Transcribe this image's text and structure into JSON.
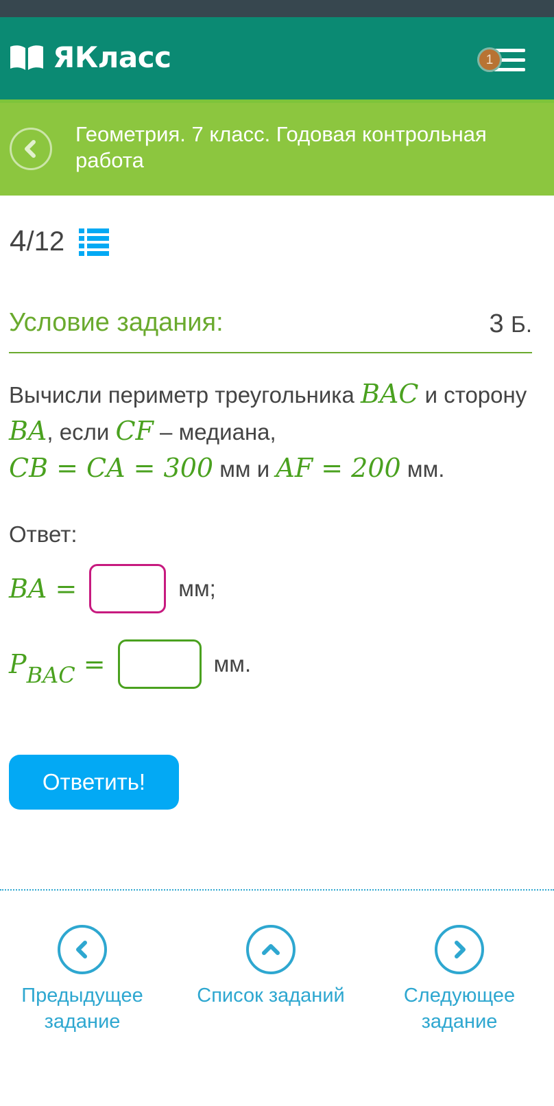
{
  "app": {
    "name": "ЯКласс",
    "notification_count": "1"
  },
  "course": {
    "title": "Геометрия. 7 класс. Годовая контрольная работа"
  },
  "progress": {
    "current": "4",
    "total": "/12"
  },
  "condition": {
    "title": "Условие задания:",
    "score": "3",
    "score_unit": "Б."
  },
  "task": {
    "t1": "Вычисли периметр треугольника ",
    "m1": "BAC",
    "t2": " и сторону ",
    "m2": "BA",
    "t3": ", если ",
    "m3": "CF",
    "t4": " – медиана,",
    "m4": "CB = CA = 300",
    "t5": " мм и ",
    "m5": "AF = 200",
    "t6": " мм."
  },
  "answer": {
    "label": "Ответ:",
    "row1": {
      "lhs": "BA =",
      "value": "",
      "unit": "мм;"
    },
    "row2": {
      "lhs_main": "P",
      "lhs_sub": "BAC",
      "lhs_eq": " =",
      "value": "",
      "unit": "мм."
    }
  },
  "submit": {
    "label": "Ответить!"
  },
  "nav": {
    "prev": "Предыдущее задание",
    "list": "Список заданий",
    "next": "Следующее задание"
  },
  "colors": {
    "topbar": "#0b8a73",
    "subbar": "#8cc63f",
    "accent_green": "#6aaa2e",
    "math_green": "#4aa11f",
    "link_blue": "#2ea7d0",
    "button_blue": "#03a9f4",
    "input_pink": "#c71a7f"
  }
}
